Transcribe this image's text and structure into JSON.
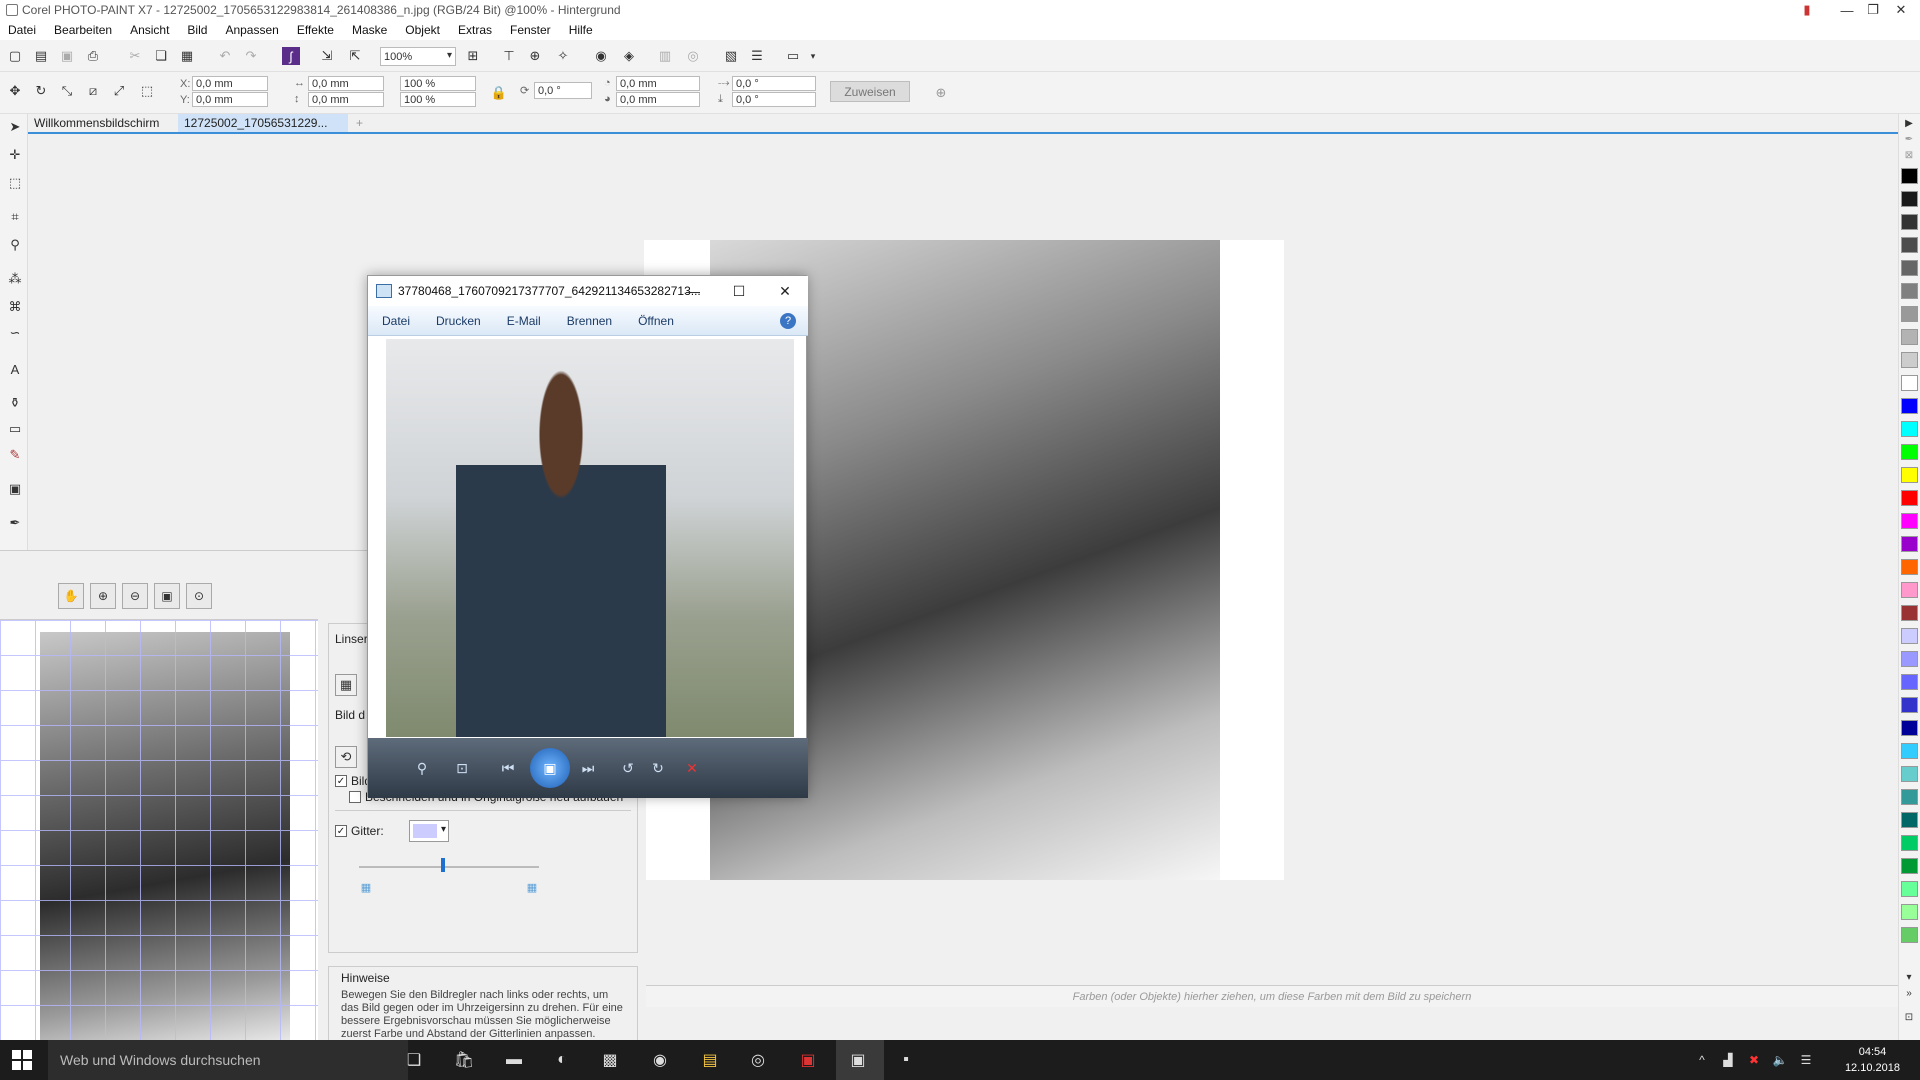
{
  "window": {
    "title": "Corel PHOTO-PAINT X7 - 12725002_1705653122983814_261408386_n.jpg (RGB/24 Bit) @100% - Hintergrund"
  },
  "menu": [
    "Datei",
    "Bearbeiten",
    "Ansicht",
    "Bild",
    "Anpassen",
    "Effekte",
    "Maske",
    "Objekt",
    "Extras",
    "Fenster",
    "Hilfe"
  ],
  "toolbar": {
    "zoom": "100%",
    "x": "0,0 mm",
    "y": "0,0 mm",
    "w": "0,0 mm",
    "h": "0,0 mm",
    "sx": "100 %",
    "sy": "100 %",
    "rot": "0,0 °",
    "cx": "0,0 mm",
    "cy": "0,0 mm",
    "skx": "0,0 °",
    "sky": "0,0 °",
    "assign_label": "Zuweisen",
    "x_label": "X:",
    "y_label": "Y:"
  },
  "tabs": {
    "welcome": "Willkommensbildschirm",
    "doc": "12725002_17056531229..."
  },
  "docker": {
    "section1": "Linser",
    "section2": "Bild d",
    "crop": "Bild beschneiden",
    "crop_rebuild": "Beschneiden und in Originalgröße neu aufbauen",
    "grid_label": "Gitter:",
    "hint_title": "Hinweise",
    "hint_body": "Bewegen Sie den Bildregler nach links oder rechts, um das Bild gegen oder im Uhrzeigersinn zu drehen. Für eine bessere Ergebnisvorschau müssen Sie möglicherweise zuerst Farbe und Abstand der Gitterlinien anpassen."
  },
  "palette_colors": [
    "#000000",
    "#1a1a1a",
    "#333333",
    "#4d4d4d",
    "#666666",
    "#808080",
    "#999999",
    "#b3b3b3",
    "#cccccc",
    "#ffffff",
    "#0000ff",
    "#00ffff",
    "#00ff00",
    "#ffff00",
    "#ff0000",
    "#ff00ff",
    "#9900cc",
    "#ff6600",
    "#ff99cc",
    "#993333",
    "#ccccff",
    "#9999ff",
    "#6666ff",
    "#3333cc",
    "#000099",
    "#33ccff",
    "#66cccc",
    "#339999",
    "#006666",
    "#00cc66",
    "#009933",
    "#66ff99",
    "#99ff99",
    "#66cc66"
  ],
  "doc_palette_hint": "Farben (oder Objekte) hierher ziehen, um diese Farben mit dem Bild zu speichern",
  "viewer": {
    "title": "37780468_1760709217377707_642921134653282713...",
    "menu": [
      "Datei",
      "Drucken",
      "E-Mail",
      "Brennen",
      "Öffnen"
    ]
  },
  "taskbar": {
    "search": "Web und Windows durchsuchen",
    "time": "04:54",
    "date": "12.10.2018"
  },
  "colors": {
    "accent": "#3b8fd9",
    "taskbar": "#1c1c1c"
  }
}
